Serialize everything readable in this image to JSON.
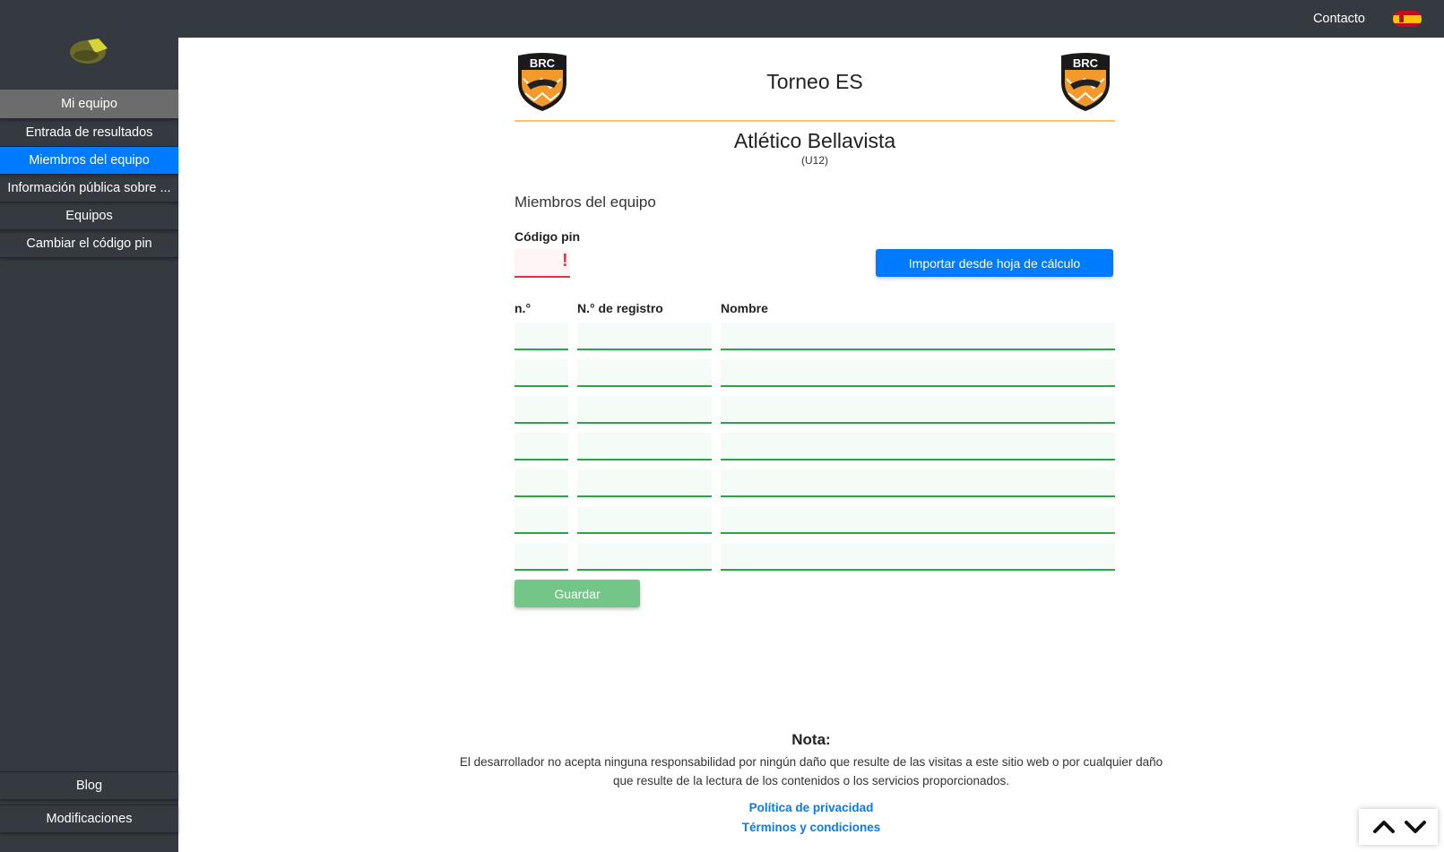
{
  "sidebar": {
    "items": [
      {
        "label": "Mi equipo"
      },
      {
        "label": "Entrada de resultados"
      },
      {
        "label": "Miembros del equipo"
      },
      {
        "label": "Información pública sobre ..."
      },
      {
        "label": "Equipos"
      },
      {
        "label": "Cambiar el código pin"
      }
    ],
    "bottom": [
      {
        "label": "Blog"
      },
      {
        "label": "Modificaciones"
      }
    ]
  },
  "topbar": {
    "contact": "Contacto",
    "language_icon": "spain-flag-icon"
  },
  "header": {
    "logo_text": "BRC",
    "tournament": "Torneo ES",
    "team": "Atlético Bellavista",
    "category": "(U12)"
  },
  "members": {
    "title": "Miembros del equipo",
    "pin_label": "Código pin",
    "pin_value": "",
    "pin_error_mark": "!",
    "import_button": "Importar desde hoja de cálculo",
    "columns": [
      "n.°",
      "N.° de registro",
      "Nombre"
    ],
    "rows": [
      {
        "num": "",
        "reg": "",
        "name": ""
      },
      {
        "num": "",
        "reg": "",
        "name": ""
      },
      {
        "num": "",
        "reg": "",
        "name": ""
      },
      {
        "num": "",
        "reg": "",
        "name": ""
      },
      {
        "num": "",
        "reg": "",
        "name": ""
      },
      {
        "num": "",
        "reg": "",
        "name": ""
      },
      {
        "num": "",
        "reg": "",
        "name": ""
      }
    ],
    "save_button": "Guardar"
  },
  "footer": {
    "note_title": "Nota:",
    "note_text": "El desarrollador no acepta ninguna responsabilidad por ningún daño que resulte de las visitas a este sitio web o por cualquier daño que resulte de la lectura de los contenidos o los servicios proporcionados.",
    "privacy": "Política de privacidad",
    "terms": "Términos y condiciones"
  },
  "colors": {
    "sidebar": "#343a40",
    "active": "#007bff",
    "save": "#73c687",
    "valid_border": "#28a745",
    "error": "#dc3545",
    "accent_line": "#f4c66a"
  }
}
